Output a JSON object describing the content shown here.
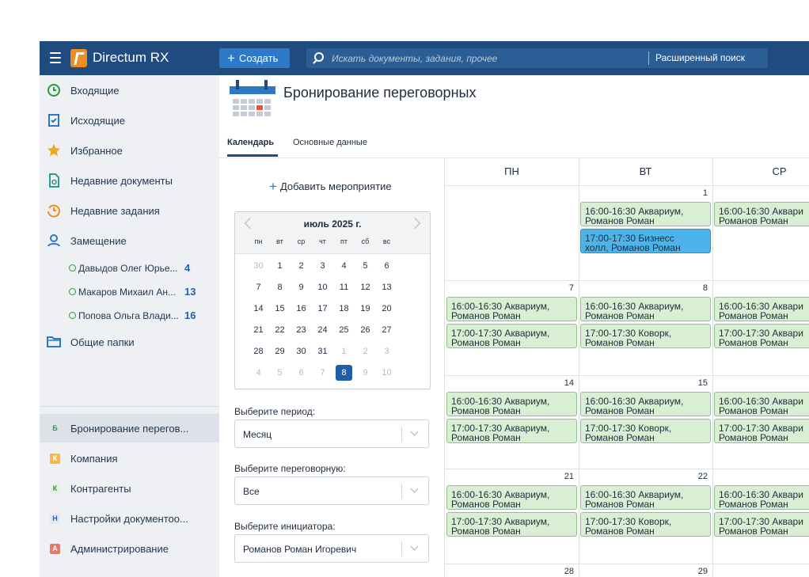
{
  "topbar": {
    "app_title": "Directum RX",
    "create_label": "Создать",
    "search_placeholder": "Искать документы, задания, прочее",
    "advanced_search": "Расширенный поиск"
  },
  "sidebar": {
    "items": [
      {
        "label": "Входящие"
      },
      {
        "label": "Исходящие"
      },
      {
        "label": "Избранное"
      },
      {
        "label": "Недавние документы"
      },
      {
        "label": "Недавние задания"
      },
      {
        "label": "Замещение"
      }
    ],
    "substitutions": [
      {
        "name": "Давыдов Олег Юрье...",
        "count": "4"
      },
      {
        "name": "Макаров Михаил Ан...",
        "count": "13"
      },
      {
        "name": "Попова Ольга Влади...",
        "count": "16"
      }
    ],
    "shared_folders": "Общие папки",
    "modules": [
      {
        "letter": "Б",
        "label": "Бронирование перегов...",
        "color": "#2b9a3c",
        "bg": "#dde2e8"
      },
      {
        "letter": "К",
        "label": "Компания",
        "color": "#ffffff",
        "bg": "#f5b94a"
      },
      {
        "letter": "К",
        "label": "Контрагенты",
        "color": "#2b9a3c",
        "bg": "#e6f1e4"
      },
      {
        "letter": "Н",
        "label": "Настройки документоо...",
        "color": "#2060b5",
        "bg": "#e1e9f4"
      },
      {
        "letter": "А",
        "label": "Администрирование",
        "color": "#ffffff",
        "bg": "#e8785f"
      }
    ]
  },
  "main": {
    "title": "Бронирование переговорных",
    "tabs": [
      "Календарь",
      "Основные данные"
    ],
    "add_event": "Добавить мероприятие",
    "mini_calendar": {
      "month": "июль 2025 г.",
      "weekdays": [
        "пн",
        "вт",
        "ср",
        "чт",
        "пт",
        "сб",
        "вс"
      ],
      "weeks": [
        [
          "30",
          "1",
          "2",
          "3",
          "4",
          "5",
          "6"
        ],
        [
          "7",
          "8",
          "9",
          "10",
          "11",
          "12",
          "13"
        ],
        [
          "14",
          "15",
          "16",
          "17",
          "18",
          "19",
          "20"
        ],
        [
          "21",
          "22",
          "23",
          "24",
          "25",
          "26",
          "27"
        ],
        [
          "28",
          "29",
          "30",
          "31",
          "1",
          "2",
          "3"
        ],
        [
          "4",
          "5",
          "6",
          "7",
          "8",
          "9",
          "10"
        ]
      ],
      "today": "8"
    },
    "filters": {
      "period_label": "Выберите период:",
      "period_value": "Месяц",
      "room_label": "Выберите переговорную:",
      "room_value": "Все",
      "initiator_label": "Выберите инициатора:",
      "initiator_value": "Романов Роман Игоревич"
    },
    "calendar": {
      "day_headers": [
        "ПН",
        "ВТ",
        "СР"
      ],
      "weeks": [
        {
          "days": [
            "",
            "1",
            ""
          ],
          "events": [
            [],
            [
              "16:00-16:30 Аквариум,\nРоманов Роман",
              "17:00-17:30 Бизнесс\nхолл, Романов Роман"
            ],
            [
              "16:00-16:30 Аквари\nРоманов Роман"
            ]
          ]
        },
        {
          "days": [
            "7",
            "8",
            ""
          ],
          "events": [
            [
              "16:00-16:30 Аквариум,\nРоманов Роман",
              "17:00-17:30 Аквариум,\nРоманов Роман"
            ],
            [
              "16:00-16:30 Аквариум,\nРоманов Роман",
              "17:00-17:30 Коворк,\nРоманов Роман"
            ],
            [
              "16:00-16:30 Аквари\nРоманов Роман",
              "17:00-17:30 Аквари\nРоманов Роман"
            ]
          ]
        },
        {
          "days": [
            "14",
            "15",
            ""
          ],
          "events": [
            [
              "16:00-16:30 Аквариум,\nРоманов Роман",
              "17:00-17:30 Аквариум,\nРоманов Роман"
            ],
            [
              "16:00-16:30 Аквариум,\nРоманов Роман",
              "17:00-17:30 Коворк,\nРоманов Роман"
            ],
            [
              "16:00-16:30 Аквари\nРоманов Роман",
              "17:00-17:30 Аквари\nРоманов Роман"
            ]
          ]
        },
        {
          "days": [
            "21",
            "22",
            ""
          ],
          "events": [
            [
              "16:00-16:30 Аквариум,\nРоманов Роман",
              "17:00-17:30 Аквариум,\nРоманов Роман"
            ],
            [
              "16:00-16:30 Аквариум,\nРоманов Роман",
              "17:00-17:30 Коворк,\nРоманов Роман"
            ],
            [
              "16:00-16:30 Аквари\nРоманов Роман",
              "17:00-17:30 Аквари\nРоманов Роман"
            ]
          ]
        },
        {
          "days": [
            "28",
            "29",
            ""
          ],
          "events": [
            [],
            [],
            []
          ]
        }
      ]
    }
  },
  "colors": {
    "topbar": "#1f4b7f",
    "accent": "#2e78c8",
    "event_green": "#d8efd3",
    "event_blue": "#4db4ea"
  }
}
